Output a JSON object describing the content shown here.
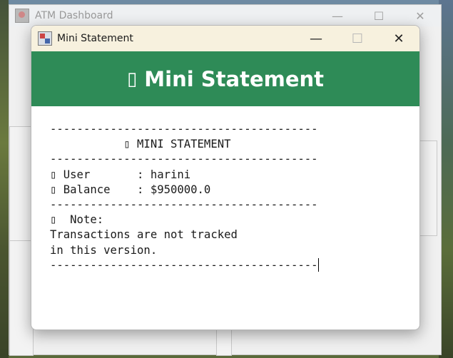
{
  "background_window": {
    "title": "ATM Dashboard",
    "controls": [
      "—",
      "☐",
      "✕"
    ]
  },
  "dialog": {
    "title": "Mini Statement",
    "controls": {
      "minimize": "—",
      "maximize": "☐",
      "close": "✕"
    }
  },
  "header": {
    "glyph": "▯",
    "title": "Mini Statement"
  },
  "statement": {
    "lines": [
      "----------------------------------------",
      "           ▯ MINI STATEMENT",
      "----------------------------------------",
      "▯ User       : harini",
      "▯ Balance    : $950000.0",
      "----------------------------------------",
      "▯  Note:",
      "Transactions are not tracked",
      "in this version.",
      "----------------------------------------"
    ]
  },
  "colors": {
    "header_bg": "#2e8b57",
    "titlebar_bg": "#f7f1de"
  }
}
